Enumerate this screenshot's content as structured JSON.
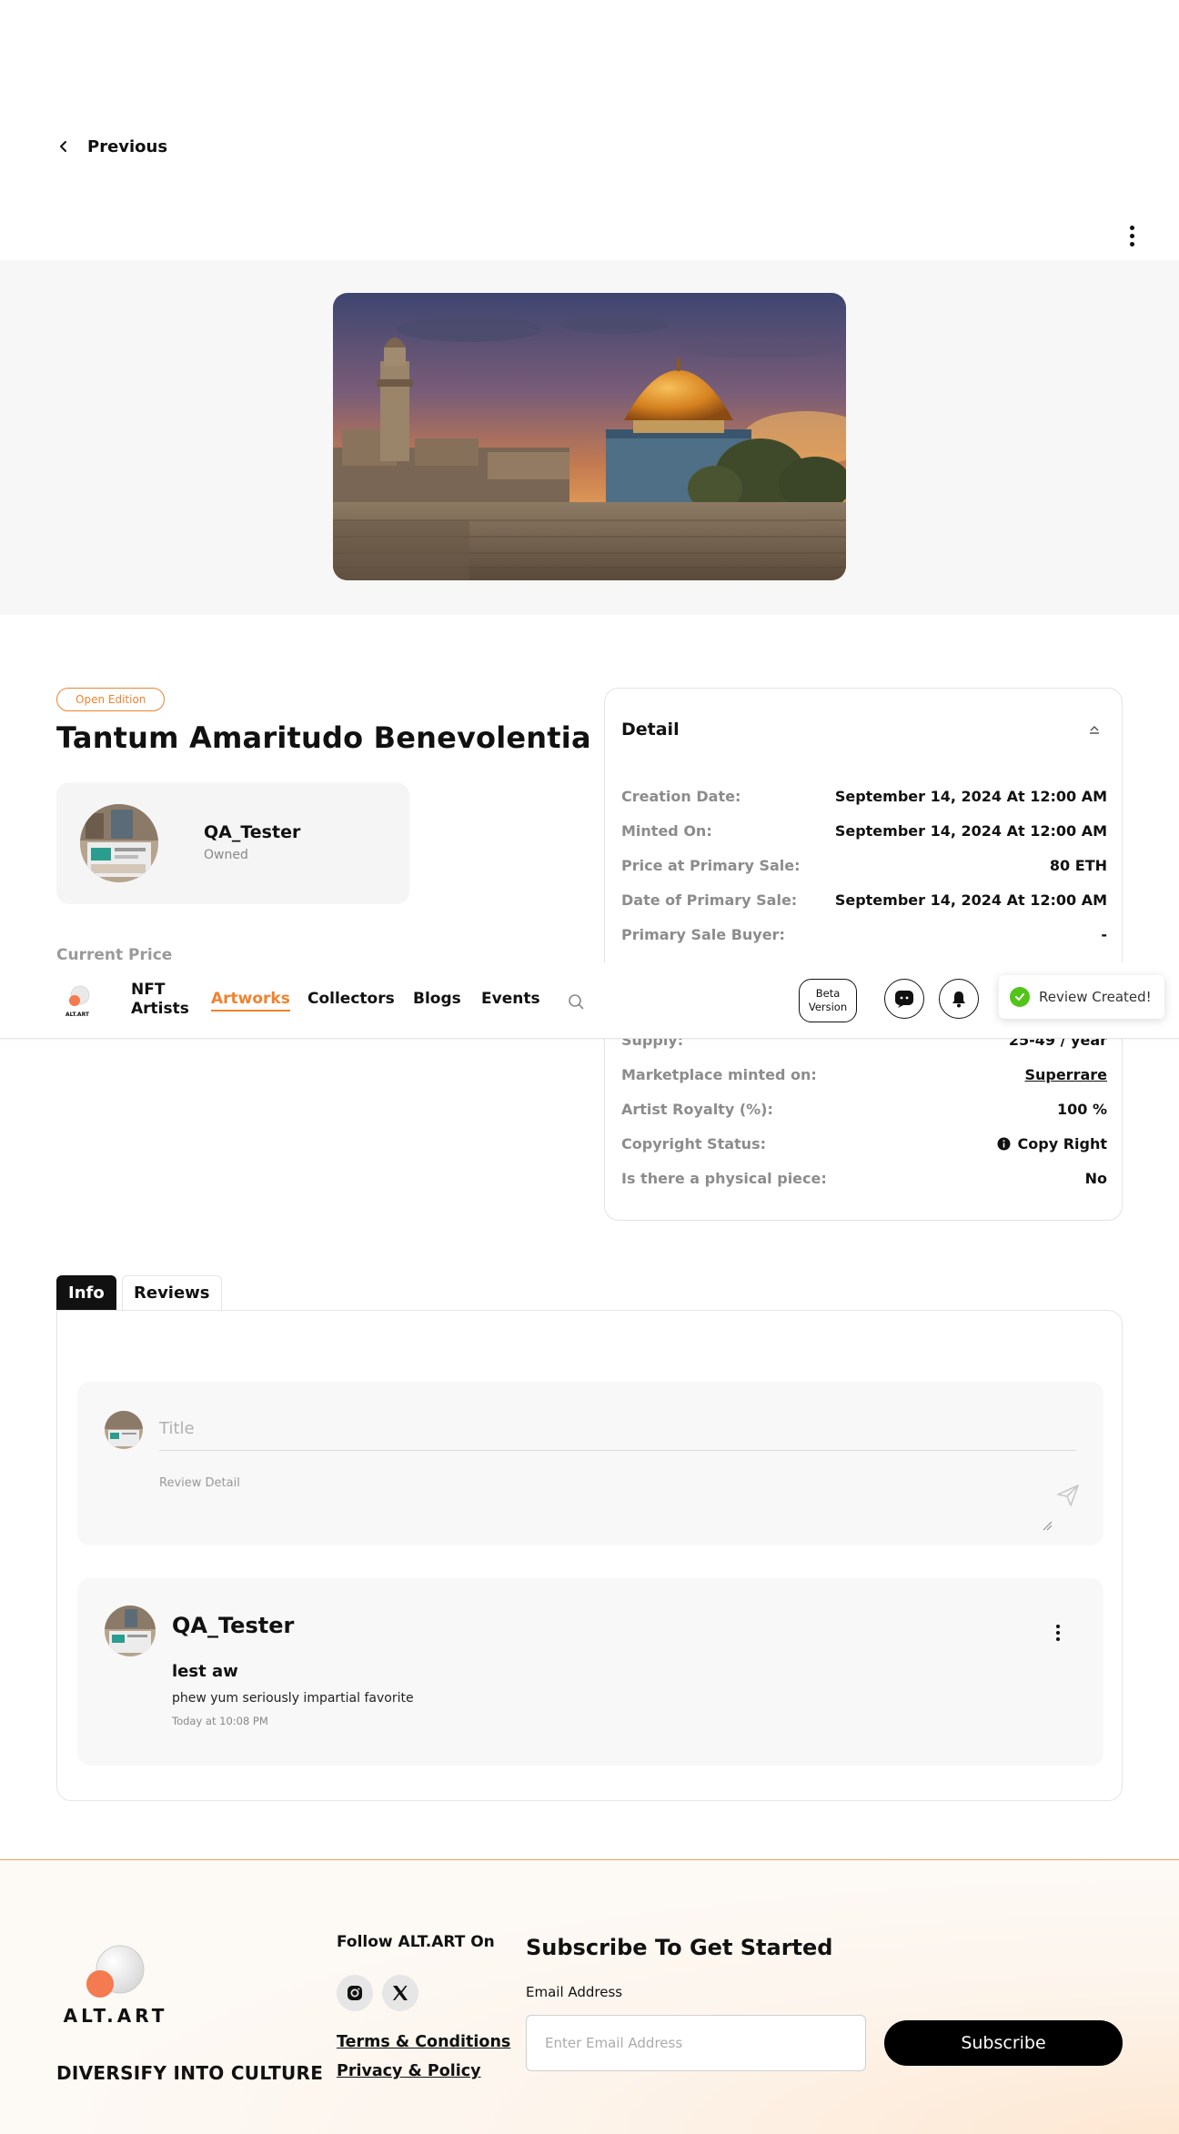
{
  "nav_back": {
    "label": "Previous"
  },
  "artwork": {
    "edition_badge": "Open Edition",
    "title": "Tantum Amaritudo Benevolentia",
    "owner": {
      "name": "QA_Tester",
      "status": "Owned"
    },
    "current_price_label": "Current Price"
  },
  "detail": {
    "title": "Detail",
    "rows": [
      {
        "label": "Creation Date:",
        "value": "September 14, 2024 At 12:00 AM"
      },
      {
        "label": "Minted On:",
        "value": "September 14, 2024 At 12:00 AM"
      },
      {
        "label": "Price at Primary Sale:",
        "value": "80 ETH"
      },
      {
        "label": "Date of Primary Sale:",
        "value": "September 14, 2024 At 12:00 AM"
      },
      {
        "label": "Primary Sale Buyer:",
        "value": "-"
      },
      {
        "label": "Supply:",
        "value": "25-49 / year"
      },
      {
        "label": "Marketplace minted on:",
        "value": "Superrare"
      },
      {
        "label": "Artist Royalty (%):",
        "value": "100 %"
      },
      {
        "label": "Copyright Status:",
        "value": "Copy Right"
      },
      {
        "label": "Is there a physical piece:",
        "value": "No"
      }
    ]
  },
  "navbar": {
    "links": [
      "NFT Artists",
      "Artworks",
      "Collectors",
      "Blogs",
      "Events"
    ],
    "active": "Artworks",
    "beta_label": "Beta Version"
  },
  "toast": {
    "message": "Review Created!"
  },
  "tabs": {
    "info": "Info",
    "reviews": "Reviews"
  },
  "review_form": {
    "title_placeholder": "Title",
    "detail_placeholder": "Review Detail"
  },
  "review": {
    "user": "QA_Tester",
    "title": "lest aw",
    "body": "phew yum seriously impartial favorite",
    "time": "Today at 10:08 PM"
  },
  "footer": {
    "brand": "ALT.ART",
    "tagline": "DIVERSIFY INTO CULTURE",
    "follow": "Follow ALT.ART On",
    "terms": "Terms & Conditions",
    "privacy": "Privacy & Policy",
    "subscribe_title": "Subscribe To Get Started",
    "email_label": "Email Address",
    "email_placeholder": "Enter Email Address",
    "subscribe_button": "Subscribe"
  },
  "colors": {
    "accent": "#f0822e",
    "success": "#52c41a",
    "card_bg": "#f5f5f5"
  }
}
